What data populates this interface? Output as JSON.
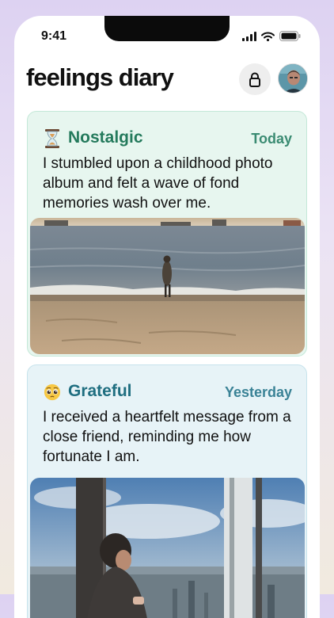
{
  "status_bar": {
    "time": "9:41",
    "icons": [
      "signal-icon",
      "wifi-icon",
      "battery-icon"
    ]
  },
  "header": {
    "title": "feelings diary",
    "lock_icon": "lock-icon",
    "avatar": "user-avatar"
  },
  "entries": [
    {
      "emoji": "hourglass",
      "feeling": "Nostalgic",
      "date": "Today",
      "text": "I stumbled upon a childhood photo album and felt a wave of fond memories wash over me.",
      "photo": "beach-photo",
      "accent": "#247a5c"
    },
    {
      "emoji": "pleading-face",
      "feeling": "Grateful",
      "date": "Yesterday",
      "text": "I received a heartfelt message from a close friend, reminding me how fortunate I am.",
      "photo": "city-window-photo",
      "accent": "#1f6e80"
    }
  ]
}
